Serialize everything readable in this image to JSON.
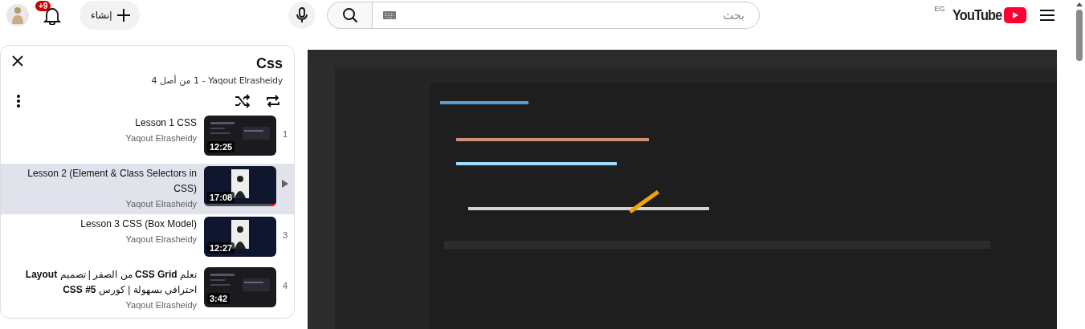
{
  "header": {
    "logo": "YouTube",
    "country": "EG",
    "search": {
      "placeholder": "بحث"
    },
    "create_label": "إنشاء",
    "notifications_badge": "+9"
  },
  "playlist": {
    "title": "Css",
    "owner": "Yaqout Elrasheidy",
    "position": "- 1 من أصل 4",
    "items": [
      {
        "index": "1",
        "title": "Lesson 1 CSS",
        "channel": "Yaqout Elrasheidy",
        "duration": "12:25",
        "selected": false
      },
      {
        "title": "Lesson 2 (Element & Class Selectors in CSS)",
        "channel": "Yaqout Elrasheidy",
        "duration": "17:08",
        "selected": true,
        "level": 0.08
      },
      {
        "index": "3",
        "title": "Lesson 3 CSS (Box Model)",
        "channel": "Yaqout Elrasheidy",
        "duration": "12:27",
        "selected": false
      },
      {
        "index": "4",
        "title": "تعلم **CSS Grid** من الصفر | تصميم **Layout** احترافي بسهولة | كورس **CSS #5**",
        "channel": "Yaqout Elrasheidy",
        "duration": "3:42",
        "selected": false
      }
    ]
  }
}
